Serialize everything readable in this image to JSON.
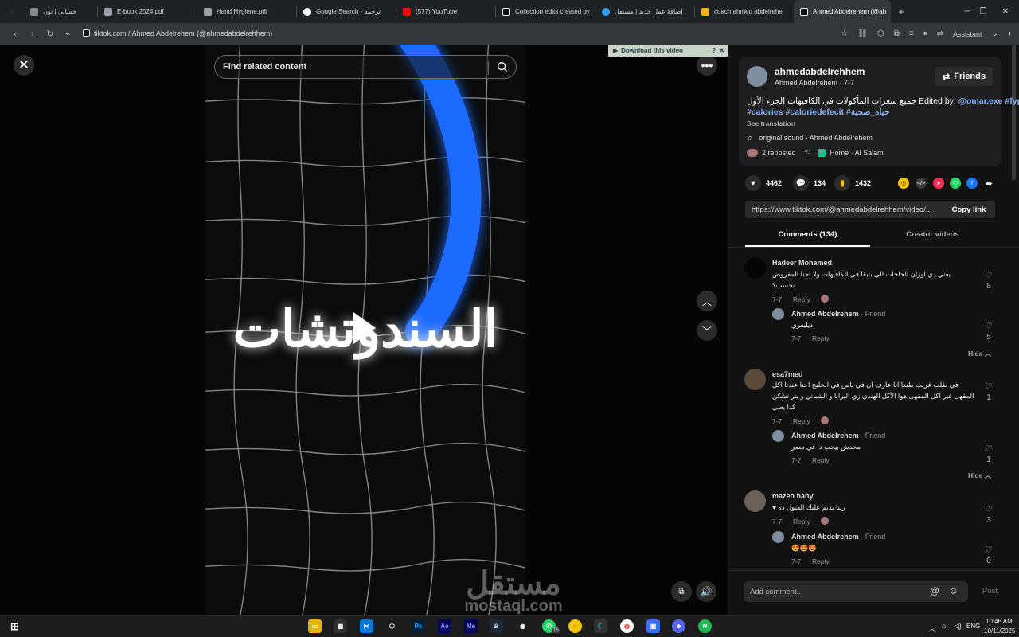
{
  "browser": {
    "tabs": [
      {
        "label": "حسابي | تون",
        "color": "#888888"
      },
      {
        "label": "E-book 2024.pdf",
        "color": "#9aa0a6"
      },
      {
        "label": "Hand Hygiene.pdf",
        "color": "#9aa0a6"
      },
      {
        "label": "Google Search - ترجمه",
        "color": "#ffffff"
      },
      {
        "label": "(577) YouTube",
        "color": "#ff0000"
      },
      {
        "label": "Collection edits created by",
        "color": "#111111"
      },
      {
        "label": "إضافة عمل جديد | مستقل",
        "color": "#2ea3f2"
      },
      {
        "label": "coach ahmed abdelrehe",
        "color": "#f4b400"
      },
      {
        "label": "Ahmed Abdelrehem (@ah",
        "color": "#111111"
      }
    ],
    "url": "tiktok.com / Ahmed Abdelrehem (@ahmedabdelrehhem)",
    "assistant_label": "Assistant"
  },
  "video": {
    "search_placeholder": "Find related content",
    "overlay_text": "السندوتشات",
    "download_banner": "Download this video",
    "watermark_ar": "مستقل",
    "watermark_en": "mostaql.com"
  },
  "author": {
    "username": "ahmedabdelrehhem",
    "display": "Ahmed Abdelrehem · 7-7",
    "friends_label": "Friends",
    "caption_ar": "جميع سعرات المأكولات في الكافيهات الجزء الأول",
    "caption_edited": "Edited by:",
    "caption_mention": "@omar.exe",
    "caption_tags1": "#fyp",
    "caption_tags2": "#calories #caloriedefecit #حياه_صحية",
    "see_translation": "See translation",
    "sound": "original sound - Ahmed Abdelrehem",
    "reposted": "2 reposted",
    "location": "Home · Al Salam"
  },
  "stats": {
    "likes": "4462",
    "comments": "134",
    "saves": "1432"
  },
  "share": {
    "link": "https://www.tiktok.com/@ahmedabdelrehhem/video/...",
    "copy_label": "Copy link"
  },
  "tabs": {
    "comments": "Comments (134)",
    "creator": "Creator videos"
  },
  "comments": [
    {
      "name": "Hadeer Mohamed",
      "text1": "يعني دي اوزان الحاجات الي بتبقا في الكافيهات ولا احنا المفروض",
      "text2": "نحسب؟",
      "date": "7-7",
      "reply": "Reply",
      "likes": "8",
      "reply_author": "Ahmed Abdelrehem",
      "reply_tag": "· Friend",
      "reply_text": "ديليفري",
      "reply_date": "7-7",
      "reply_likes": "5",
      "hide": "Hide"
    },
    {
      "name": "esa7med",
      "text1": "في طلب غريب طبعا انا عارف ان في ناس في الخليج احنا عندنا اكل",
      "text2": "المقهى غير اكل المقهى هوا الأكل الهندي زي البرانا و الشباتي و بتر تشكن",
      "text3": "كدا يعني",
      "date": "7-7",
      "reply": "Reply",
      "likes": "1",
      "reply_author": "Ahmed Abdelrehem",
      "reply_tag": "· Friend",
      "reply_text": "محدش بيحب دا في مصر",
      "reply_date": "7-7",
      "reply_likes": "1",
      "hide": "Hide"
    },
    {
      "name": "mazen hany",
      "text1": "ربنا يديم عليك القبول ده ♥",
      "date": "7-7",
      "reply": "Reply",
      "likes": "3",
      "reply_author": "Ahmed Abdelrehem",
      "reply_tag": "· Friend",
      "reply_text": "😍😍😍",
      "reply_date": "7-7",
      "reply_likes": "0"
    }
  ],
  "composer": {
    "placeholder": "Add comment...",
    "post": "Post"
  },
  "taskbar": {
    "lang": "ENG",
    "time": "10:46 AM",
    "date": "10/11/2025",
    "badge": "15"
  },
  "colors": {
    "accent_blue": "#1f6bff",
    "link_blue": "#8ab4f8",
    "tiktok_bg": "#121212"
  }
}
